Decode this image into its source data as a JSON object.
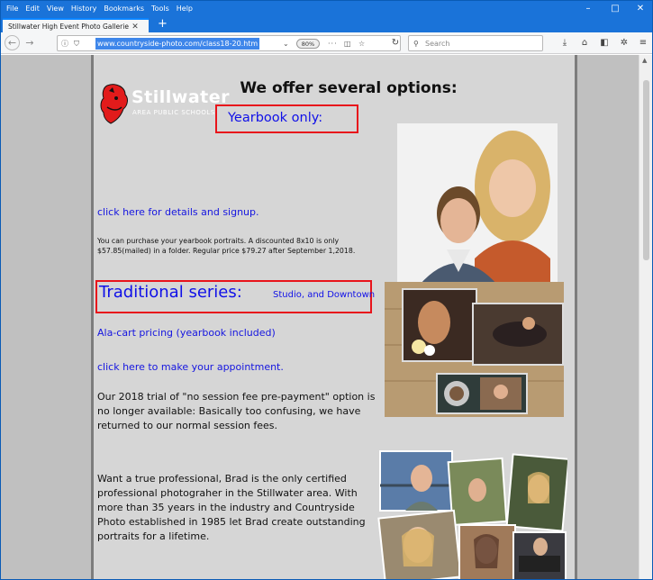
{
  "browser": {
    "menu": [
      "File",
      "Edit",
      "View",
      "History",
      "Bookmarks",
      "Tools",
      "Help"
    ],
    "tab_title": "Stillwater High Event Photo Galleries",
    "new_tab": "+",
    "url": "www.countryside-photo.com/class18-20.htm",
    "zoom": "80%",
    "search_placeholder": "Search",
    "window_controls": [
      "–",
      "□",
      "✕"
    ]
  },
  "page": {
    "heading": "We offer several options:",
    "logo": {
      "name": "Stillwater",
      "sub": "AREA PUBLIC SCHOOLS"
    },
    "yearbook_label": "Yearbook only:",
    "yearbook_link": "click here for details and signup.",
    "yearbook_desc": "You can purchase your yearbook portraits. A discounted 8x10 is only $57.85(mailed) in a folder. Regular price $79.27 after September 1,2018.",
    "traditional_label": "Traditional series:",
    "traditional_sub": "Studio, and Downtown",
    "alacart_link": "Ala-cart pricing (yearbook included)",
    "appointment_link": "click here to make your appointment.",
    "trial_text": "Our 2018 trial of \"no session fee pre-payment\" option is no longer available: Basically too confusing, we have returned to our normal session fees.",
    "pro_text": "Want a true professional, Brad is the only certified professional photograher in the Stillwater area. With more than 35 years in the industry and Countryside Photo established in 1985 let Brad create outstanding portraits for a lifetime."
  },
  "colors": {
    "link": "#1515e0",
    "highlight_box": "#e8141b",
    "titlebar": "#1a73d9"
  }
}
